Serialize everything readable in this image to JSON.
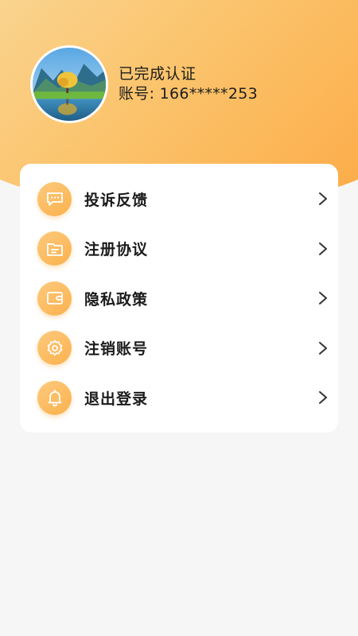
{
  "profile": {
    "verify_status": "已完成认证",
    "account_label": "账号:",
    "account_value": "166*****253"
  },
  "menu": {
    "items": [
      {
        "label": "投诉反馈",
        "icon": "chat-bubble-icon"
      },
      {
        "label": "注册协议",
        "icon": "folder-document-icon"
      },
      {
        "label": "隐私政策",
        "icon": "wallet-icon"
      },
      {
        "label": "注销账号",
        "icon": "gear-icon"
      },
      {
        "label": "退出登录",
        "icon": "bell-icon"
      }
    ]
  },
  "colors": {
    "header_gradient_start": "#fad796",
    "header_gradient_end": "#fca944",
    "icon_circle": "#fbbd5e",
    "card_bg": "#ffffff",
    "page_bg": "#f6f6f6"
  }
}
